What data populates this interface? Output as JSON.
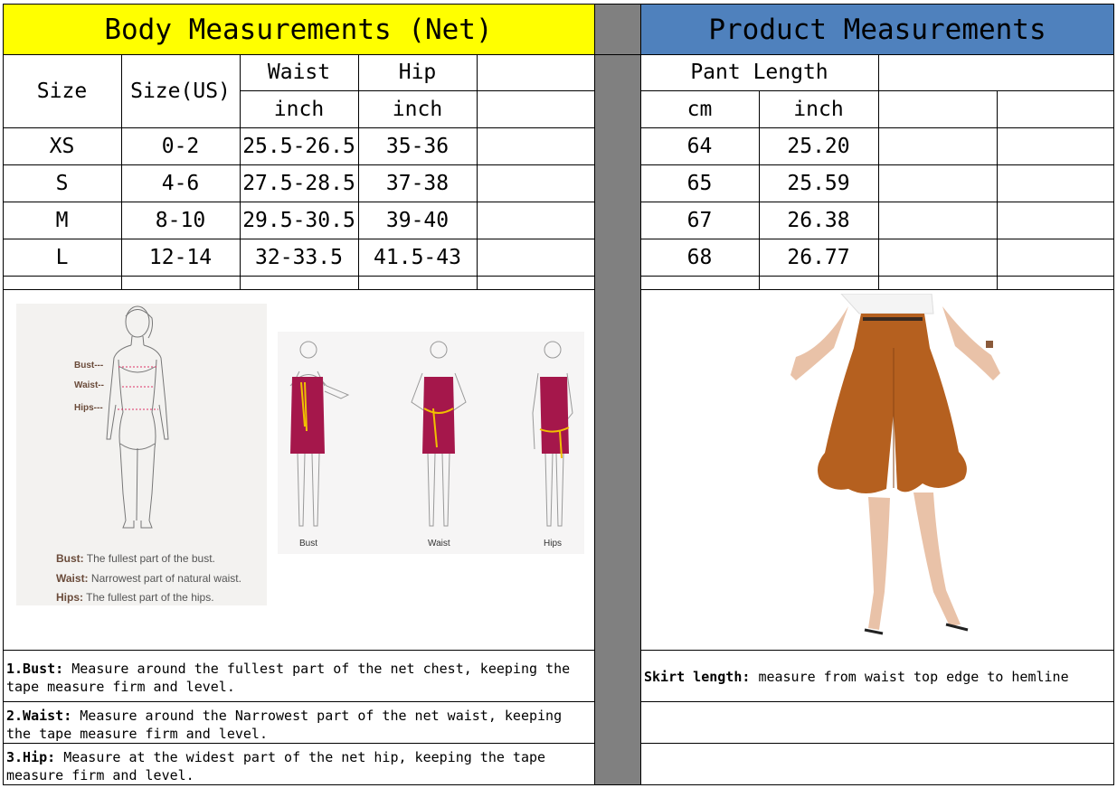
{
  "left_header": "Body Measurements (Net)",
  "right_header": "Product Measurements",
  "columns": {
    "size": "Size",
    "size_us": "Size(US)",
    "waist": "Waist",
    "hip": "Hip",
    "waist_unit": "inch",
    "hip_unit": "inch",
    "pant_length": "Pant Length",
    "pl_cm": "cm",
    "pl_inch": "inch"
  },
  "rows": [
    {
      "size": "XS",
      "us": "0-2",
      "waist": "25.5-26.5",
      "hip": "35-36",
      "cm": "64",
      "inch": "25.20"
    },
    {
      "size": "S",
      "us": "4-6",
      "waist": "27.5-28.5",
      "hip": "37-38",
      "cm": "65",
      "inch": "25.59"
    },
    {
      "size": "M",
      "us": "8-10",
      "waist": "29.5-30.5",
      "hip": "39-40",
      "cm": "67",
      "inch": "26.38"
    },
    {
      "size": "L",
      "us": "12-14",
      "waist": "32-33.5",
      "hip": "41.5-43",
      "cm": "68",
      "inch": "26.77"
    }
  ],
  "figure_left": {
    "bust": "Bust---",
    "waist": "Waist--",
    "hips": "Hips---",
    "def_bust_label": "Bust:",
    "def_bust": "The fullest part of the bust.",
    "def_waist_label": "Waist:",
    "def_waist": "Narrowest part of natural waist.",
    "def_hips_label": "Hips:",
    "def_hips": "The fullest part of the hips."
  },
  "figure_mid": {
    "bust": "Bust",
    "waist": "Waist",
    "hips": "Hips"
  },
  "notes": {
    "bust_label": "1.Bust:",
    "bust_text": "Measure around the fullest part of the net chest, keeping the tape  measure firm and level.",
    "waist_label": "2.Waist:",
    "waist_text": "Measure around the Narrowest part of the net waist, keeping the tape  measure firm and level.",
    "hip_label": "3.Hip:",
    "hip_text": "Measure at the widest part of the net hip, keeping the tape measure firm and level.",
    "skirt_label": "Skirt length:",
    "skirt_text": "measure from waist top edge to hemline"
  },
  "colors": {
    "yellow": "#ffff00",
    "blue": "#4f81bd",
    "gray": "#808080",
    "dress": "#a5174b",
    "pants": "#b5601f"
  }
}
